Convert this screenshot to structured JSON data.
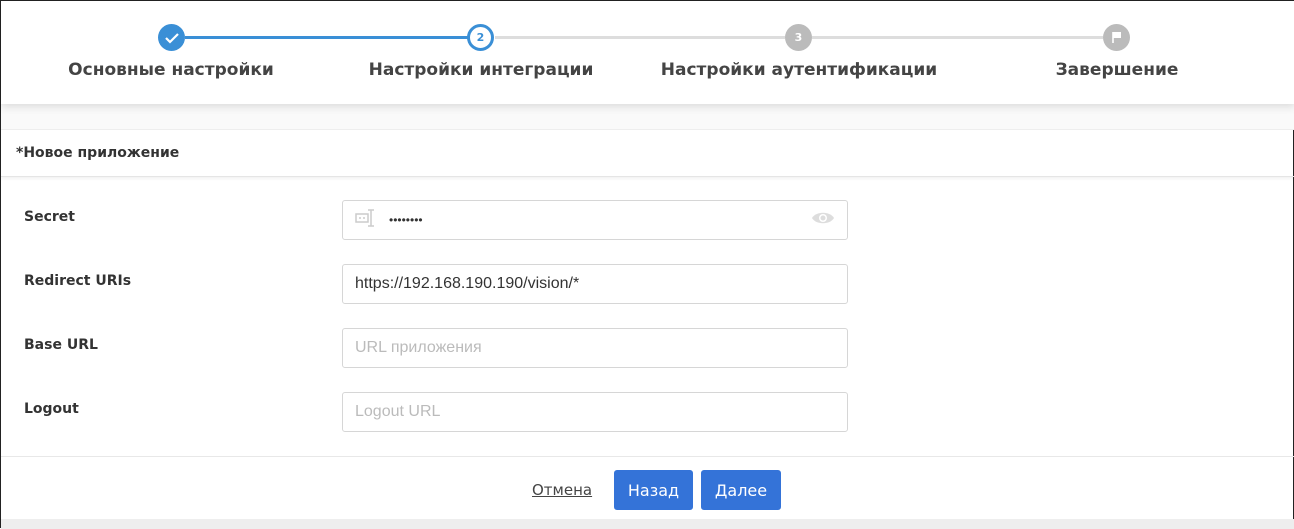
{
  "stepper": {
    "steps": [
      {
        "label": "Основные настройки",
        "state": "done",
        "number": "1"
      },
      {
        "label": "Настройки интеграции",
        "state": "active",
        "number": "2"
      },
      {
        "label": "Настройки аутентификации",
        "state": "todo",
        "number": "3"
      },
      {
        "label": "Завершение",
        "state": "todo",
        "number": ""
      }
    ]
  },
  "card": {
    "title": "*Новое приложение"
  },
  "form": {
    "secret": {
      "label": "Secret",
      "value": "••••••••"
    },
    "redirect": {
      "label": "Redirect URIs",
      "value": "https://192.168.190.190/vision/*"
    },
    "base": {
      "label": "Base URL",
      "placeholder": "URL приложения"
    },
    "logout": {
      "label": "Logout",
      "placeholder": "Logout URL"
    }
  },
  "footer": {
    "cancel": "Отмена",
    "back": "Назад",
    "next": "Далее"
  },
  "colors": {
    "accent": "#3a8fd6",
    "button": "#3473d8"
  }
}
